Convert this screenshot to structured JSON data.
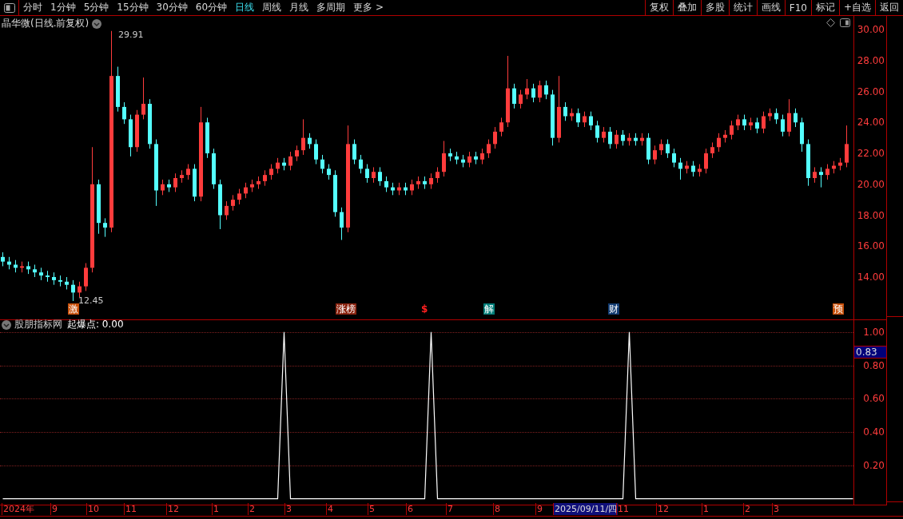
{
  "toolbar": {
    "periods": [
      {
        "label": "分时",
        "selected": false
      },
      {
        "label": "1分钟",
        "selected": false
      },
      {
        "label": "5分钟",
        "selected": false
      },
      {
        "label": "15分钟",
        "selected": false
      },
      {
        "label": "30分钟",
        "selected": false
      },
      {
        "label": "60分钟",
        "selected": false
      },
      {
        "label": "日线",
        "selected": true
      },
      {
        "label": "周线",
        "selected": false
      },
      {
        "label": "月线",
        "selected": false
      },
      {
        "label": "多周期",
        "selected": false
      },
      {
        "label": "更多 >",
        "selected": false
      }
    ],
    "actions": [
      "复权",
      "叠加",
      "多股",
      "统计",
      "画线",
      "F10",
      "标记",
      "+自选",
      "返回"
    ]
  },
  "price_chart": {
    "title": "晶华微(日线.前复权)",
    "high_label": "29.91",
    "low_label": "12.45",
    "events": [
      {
        "label": "激",
        "kind": "badge",
        "color": "#c8500a"
      },
      {
        "label": "涨榜",
        "kind": "badge",
        "color": "#8b2410"
      },
      {
        "label": "$",
        "kind": "symbol",
        "color": "#ff2020"
      },
      {
        "label": "解",
        "kind": "badge",
        "color": "#007d78"
      },
      {
        "label": "财",
        "kind": "badge",
        "color": "#123c72"
      },
      {
        "label": "预",
        "kind": "badge",
        "color": "#c8500a"
      }
    ],
    "chart_data": {
      "type": "candlestick",
      "categories": [
        null,
        null,
        null,
        null,
        null,
        null,
        null,
        null,
        null,
        null,
        null,
        null,
        null,
        null,
        null,
        null,
        null,
        null,
        null,
        null,
        null,
        null,
        null,
        null,
        null,
        null,
        null,
        null,
        null,
        null,
        null,
        null,
        null,
        null,
        null,
        null,
        null,
        null,
        null,
        null,
        null,
        null,
        null,
        null,
        null,
        null,
        null,
        null,
        null,
        null,
        null,
        null,
        null,
        null,
        null,
        null,
        null,
        null,
        null,
        null,
        null,
        null,
        null,
        null,
        null,
        null,
        null,
        null,
        null,
        null,
        null,
        null,
        null,
        null,
        null,
        null,
        null,
        null,
        null,
        null,
        null,
        null,
        null,
        null,
        null,
        null,
        null,
        null,
        null,
        null,
        null,
        null,
        null,
        null,
        null,
        null,
        null,
        null,
        null,
        null,
        null,
        null,
        null,
        null,
        null,
        null,
        null,
        null,
        null,
        null,
        null,
        null,
        null,
        null,
        null,
        null,
        null,
        null,
        null,
        null,
        null,
        null,
        null,
        null,
        null,
        null,
        null,
        null,
        null,
        null,
        null,
        null,
        null
      ],
      "ohlc": [
        [
          15.3,
          15.6,
          14.7,
          15.0
        ],
        [
          15.0,
          15.3,
          14.5,
          14.8
        ],
        [
          14.8,
          15.1,
          14.3,
          14.6
        ],
        [
          14.6,
          15.0,
          14.3,
          14.7
        ],
        [
          14.7,
          15.0,
          14.2,
          14.5
        ],
        [
          14.5,
          14.8,
          14.0,
          14.3
        ],
        [
          14.3,
          14.6,
          13.8,
          14.1
        ],
        [
          14.1,
          14.4,
          13.7,
          14.0
        ],
        [
          14.0,
          14.3,
          13.5,
          13.8
        ],
        [
          13.8,
          14.1,
          13.4,
          13.7
        ],
        [
          13.7,
          14.0,
          13.2,
          13.5
        ],
        [
          13.5,
          13.8,
          12.45,
          13.0
        ],
        [
          13.0,
          13.7,
          12.7,
          13.4
        ],
        [
          13.4,
          14.9,
          13.1,
          14.6
        ],
        [
          14.6,
          22.4,
          14.3,
          20.0
        ],
        [
          20.0,
          20.3,
          16.8,
          17.5
        ],
        [
          17.5,
          17.8,
          16.6,
          17.2
        ],
        [
          17.2,
          29.91,
          16.9,
          27.0
        ],
        [
          27.0,
          27.6,
          24.7,
          25.0
        ],
        [
          25.0,
          25.3,
          23.9,
          24.2
        ],
        [
          24.2,
          24.5,
          21.8,
          22.4
        ],
        [
          22.4,
          24.8,
          22.1,
          24.5
        ],
        [
          24.5,
          26.9,
          24.2,
          25.2
        ],
        [
          25.2,
          25.5,
          22.3,
          22.6
        ],
        [
          22.6,
          22.9,
          18.6,
          19.6
        ],
        [
          19.6,
          20.3,
          19.3,
          20.0
        ],
        [
          20.0,
          20.3,
          19.5,
          19.8
        ],
        [
          19.8,
          20.7,
          19.5,
          20.4
        ],
        [
          20.4,
          20.9,
          20.1,
          20.6
        ],
        [
          20.6,
          21.3,
          20.3,
          21.0
        ],
        [
          21.0,
          21.3,
          18.9,
          19.2
        ],
        [
          19.2,
          25.0,
          18.9,
          24.0
        ],
        [
          24.0,
          24.3,
          21.7,
          22.0
        ],
        [
          22.0,
          22.3,
          19.7,
          20.0
        ],
        [
          20.0,
          20.3,
          17.1,
          18.0
        ],
        [
          18.0,
          18.9,
          17.7,
          18.6
        ],
        [
          18.6,
          19.3,
          18.3,
          19.0
        ],
        [
          19.0,
          19.7,
          18.7,
          19.4
        ],
        [
          19.4,
          20.1,
          19.1,
          19.8
        ],
        [
          19.8,
          20.3,
          19.5,
          20.0
        ],
        [
          20.0,
          20.5,
          19.7,
          20.2
        ],
        [
          20.2,
          20.9,
          19.9,
          20.6
        ],
        [
          20.6,
          21.3,
          20.3,
          21.0
        ],
        [
          21.0,
          21.7,
          20.7,
          21.4
        ],
        [
          21.4,
          21.7,
          20.9,
          21.2
        ],
        [
          21.2,
          22.1,
          20.9,
          21.8
        ],
        [
          21.8,
          22.5,
          21.5,
          22.2
        ],
        [
          22.2,
          24.2,
          21.9,
          23.0
        ],
        [
          23.0,
          23.3,
          22.3,
          22.6
        ],
        [
          22.6,
          22.9,
          21.3,
          21.6
        ],
        [
          21.6,
          21.9,
          20.7,
          21.0
        ],
        [
          21.0,
          21.3,
          20.3,
          20.6
        ],
        [
          20.6,
          20.9,
          17.9,
          18.2
        ],
        [
          18.2,
          18.5,
          16.4,
          17.2
        ],
        [
          17.2,
          23.8,
          16.9,
          22.6
        ],
        [
          22.6,
          22.9,
          21.3,
          21.6
        ],
        [
          21.6,
          21.9,
          20.7,
          21.0
        ],
        [
          21.0,
          21.3,
          20.1,
          20.4
        ],
        [
          20.4,
          21.1,
          20.1,
          20.8
        ],
        [
          20.8,
          21.1,
          19.9,
          20.2
        ],
        [
          20.2,
          20.5,
          19.5,
          19.8
        ],
        [
          19.8,
          20.1,
          19.3,
          19.6
        ],
        [
          19.6,
          20.1,
          19.3,
          19.8
        ],
        [
          19.8,
          20.1,
          19.3,
          19.6
        ],
        [
          19.6,
          20.3,
          19.3,
          20.0
        ],
        [
          20.0,
          20.5,
          19.7,
          20.2
        ],
        [
          20.2,
          20.5,
          19.7,
          20.0
        ],
        [
          20.0,
          20.7,
          19.7,
          20.4
        ],
        [
          20.4,
          21.1,
          20.1,
          20.8
        ],
        [
          20.8,
          22.8,
          20.5,
          22.0
        ],
        [
          22.0,
          22.3,
          21.5,
          21.8
        ],
        [
          21.8,
          22.1,
          21.3,
          21.6
        ],
        [
          21.6,
          21.9,
          21.1,
          21.4
        ],
        [
          21.4,
          22.1,
          21.1,
          21.8
        ],
        [
          21.8,
          22.1,
          21.3,
          21.6
        ],
        [
          21.6,
          22.3,
          21.3,
          22.0
        ],
        [
          22.0,
          22.9,
          21.7,
          22.6
        ],
        [
          22.6,
          23.7,
          22.3,
          23.4
        ],
        [
          23.4,
          24.3,
          23.1,
          24.0
        ],
        [
          24.0,
          28.3,
          23.7,
          26.2
        ],
        [
          26.2,
          26.5,
          24.9,
          25.2
        ],
        [
          25.2,
          26.1,
          24.9,
          25.8
        ],
        [
          25.8,
          26.8,
          25.5,
          26.2
        ],
        [
          26.2,
          26.5,
          25.3,
          25.6
        ],
        [
          25.6,
          26.7,
          25.3,
          26.4
        ],
        [
          26.4,
          26.7,
          25.5,
          25.8
        ],
        [
          25.8,
          26.1,
          22.5,
          23.0
        ],
        [
          23.0,
          27.0,
          22.7,
          25.0
        ],
        [
          25.0,
          25.3,
          24.1,
          24.4
        ],
        [
          24.4,
          24.9,
          24.1,
          24.6
        ],
        [
          24.6,
          24.9,
          23.7,
          24.0
        ],
        [
          24.0,
          24.7,
          23.7,
          24.4
        ],
        [
          24.4,
          24.7,
          23.5,
          23.8
        ],
        [
          23.8,
          24.1,
          22.7,
          23.0
        ],
        [
          23.0,
          23.7,
          22.7,
          23.4
        ],
        [
          23.4,
          23.7,
          22.3,
          22.6
        ],
        [
          22.6,
          23.5,
          22.3,
          23.2
        ],
        [
          23.2,
          23.5,
          22.5,
          22.8
        ],
        [
          22.8,
          23.3,
          22.5,
          23.0
        ],
        [
          23.0,
          23.3,
          22.5,
          22.8
        ],
        [
          22.8,
          23.3,
          22.5,
          23.0
        ],
        [
          23.0,
          23.3,
          21.3,
          21.6
        ],
        [
          21.6,
          22.5,
          21.3,
          22.2
        ],
        [
          22.2,
          22.9,
          21.9,
          22.6
        ],
        [
          22.6,
          22.9,
          21.7,
          22.0
        ],
        [
          22.0,
          22.3,
          21.1,
          21.4
        ],
        [
          21.4,
          21.7,
          20.3,
          21.0
        ],
        [
          21.0,
          21.5,
          20.7,
          21.2
        ],
        [
          21.2,
          21.5,
          20.5,
          20.8
        ],
        [
          20.8,
          21.3,
          20.5,
          21.0
        ],
        [
          21.0,
          22.3,
          20.7,
          22.0
        ],
        [
          22.0,
          22.7,
          21.7,
          22.4
        ],
        [
          22.4,
          23.3,
          22.1,
          23.0
        ],
        [
          23.0,
          23.5,
          22.7,
          23.2
        ],
        [
          23.2,
          24.1,
          22.9,
          23.8
        ],
        [
          23.8,
          24.5,
          23.5,
          24.2
        ],
        [
          24.2,
          24.5,
          23.5,
          23.8
        ],
        [
          23.8,
          24.3,
          23.5,
          24.0
        ],
        [
          24.0,
          24.3,
          23.3,
          23.6
        ],
        [
          23.6,
          24.7,
          23.3,
          24.4
        ],
        [
          24.4,
          24.9,
          24.1,
          24.6
        ],
        [
          24.6,
          24.9,
          23.9,
          24.2
        ],
        [
          24.2,
          24.5,
          23.1,
          23.4
        ],
        [
          23.4,
          25.5,
          23.1,
          24.6
        ],
        [
          24.6,
          24.9,
          23.7,
          24.0
        ],
        [
          24.0,
          24.3,
          22.1,
          22.6
        ],
        [
          22.6,
          22.9,
          19.9,
          20.4
        ],
        [
          20.4,
          21.1,
          20.1,
          20.8
        ],
        [
          20.8,
          21.1,
          19.8,
          20.6
        ],
        [
          20.6,
          21.3,
          20.3,
          21.0
        ],
        [
          21.0,
          21.5,
          20.7,
          21.2
        ],
        [
          21.2,
          21.7,
          20.9,
          21.4
        ],
        [
          21.4,
          23.8,
          21.1,
          22.6
        ]
      ],
      "ylim": [
        11.47,
        30.88
      ],
      "yticks": [
        {
          "value": 30,
          "label": "30.00"
        },
        {
          "value": 28,
          "label": "28.00"
        },
        {
          "value": 26,
          "label": "26.00"
        },
        {
          "value": 24,
          "label": "24.00"
        },
        {
          "value": 22,
          "label": "22.00"
        },
        {
          "value": 20,
          "label": "20.00"
        },
        {
          "value": 18,
          "label": "18.00"
        },
        {
          "value": 16,
          "label": "16.00"
        },
        {
          "value": 14,
          "label": "14.00"
        }
      ]
    }
  },
  "indicator": {
    "source": "股朋指标网",
    "reading": "起爆点: 0.00",
    "cursor_value": "0.83",
    "chart_data": {
      "type": "line",
      "categories": [
        null,
        null,
        null,
        null,
        null,
        null,
        null,
        null,
        null,
        null,
        null,
        null,
        null,
        null,
        null,
        null,
        null,
        null,
        null,
        null,
        null,
        null,
        null,
        null,
        null,
        null,
        null,
        null,
        null,
        null,
        null,
        null,
        null,
        null,
        null,
        null,
        null,
        null,
        null,
        null,
        null,
        null,
        null,
        null,
        null,
        null,
        null,
        null,
        null,
        null,
        null,
        null,
        null,
        null,
        null,
        null,
        null,
        null,
        null,
        null,
        null,
        null,
        null,
        null,
        null,
        null,
        null,
        null,
        null,
        null,
        null,
        null,
        null,
        null,
        null,
        null,
        null,
        null,
        null,
        null,
        null,
        null,
        null,
        null,
        null,
        null,
        null,
        null,
        null,
        null,
        null,
        null,
        null,
        null,
        null,
        null,
        null,
        null,
        null,
        null,
        null,
        null,
        null,
        null,
        null,
        null,
        null,
        null,
        null,
        null,
        null,
        null,
        null,
        null,
        null,
        null,
        null,
        null,
        null,
        null,
        null,
        null,
        null,
        null,
        null,
        null,
        null,
        null,
        null,
        null,
        null,
        null,
        null,
        null
      ],
      "series": [
        {
          "color": "#ffffff",
          "values": [
            0,
            0,
            0,
            0,
            0,
            0,
            0,
            0,
            0,
            0,
            0,
            0,
            0,
            0,
            0,
            0,
            0,
            0,
            0,
            0,
            0,
            0,
            0,
            0,
            0,
            0,
            0,
            0,
            0,
            0,
            0,
            0,
            0,
            0,
            0,
            0,
            0,
            0,
            0,
            0,
            0,
            0,
            0,
            0,
            1,
            0,
            0,
            0,
            0,
            0,
            0,
            0,
            0,
            0,
            0,
            0,
            0,
            0,
            0,
            0,
            0,
            0,
            0,
            0,
            0,
            0,
            0,
            1,
            0,
            0,
            0,
            0,
            0,
            0,
            0,
            0,
            0,
            0,
            0,
            0,
            0,
            0,
            0,
            0,
            0,
            0,
            0,
            0,
            0,
            0,
            0,
            0,
            0,
            0,
            0,
            0,
            0,
            0,
            1,
            0,
            0,
            0,
            0,
            0,
            0,
            0,
            0,
            0,
            0,
            0,
            0,
            0,
            0,
            0,
            0,
            0,
            0,
            0,
            0,
            0,
            0,
            0,
            0,
            0,
            0,
            0,
            0,
            0,
            0,
            0,
            0,
            0,
            0,
            0
          ]
        }
      ],
      "ylim": [
        -0.04,
        1.09
      ],
      "grid": true,
      "yticks": [
        {
          "value": 1,
          "label": "1.00"
        },
        {
          "value": 0.8,
          "label": "0.80"
        },
        {
          "value": 0.6,
          "label": "0.60"
        },
        {
          "value": 0.4,
          "label": "0.40"
        },
        {
          "value": 0.2,
          "label": "0.20"
        }
      ]
    }
  },
  "date_axis": [
    {
      "label": "2024年",
      "selected": false
    },
    {
      "label": "9",
      "selected": false
    },
    {
      "label": "10",
      "selected": false
    },
    {
      "label": "11",
      "selected": false
    },
    {
      "label": "12",
      "selected": false
    },
    {
      "label": "1",
      "selected": false
    },
    {
      "label": "2",
      "selected": false
    },
    {
      "label": "3",
      "selected": false
    },
    {
      "label": "4",
      "selected": false
    },
    {
      "label": "5",
      "selected": false
    },
    {
      "label": "6",
      "selected": false
    },
    {
      "label": "7",
      "selected": false
    },
    {
      "label": "8",
      "selected": false
    },
    {
      "label": "9",
      "selected": false
    },
    {
      "label": "2025/09/11/四",
      "selected": true
    },
    {
      "label": "11",
      "selected": false
    },
    {
      "label": "12",
      "selected": false
    },
    {
      "label": "1",
      "selected": false
    },
    {
      "label": "2",
      "selected": false
    },
    {
      "label": "3",
      "selected": false
    }
  ]
}
